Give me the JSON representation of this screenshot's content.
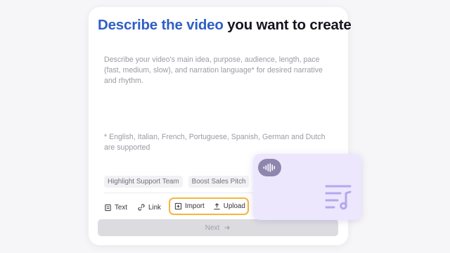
{
  "header": {
    "title_part1": "Describe the video",
    "title_part2": " you want to create"
  },
  "prompt": {
    "placeholder": "Describe your video's main idea, purpose, audience, length, pace (fast, medium, slow), and narration language* for desired narrative and rhythm.",
    "language_note": "* English, Italian, French, Portuguese, Spanish, German and Dutch are supported"
  },
  "suggestions": [
    "Highlight Support Team",
    "Boost Sales Pitch"
  ],
  "toolbar": {
    "text_label": "Text",
    "link_label": "Link",
    "import_label": "Import",
    "upload_label": "Upload"
  },
  "next_button": {
    "label": "Next"
  },
  "icons": {
    "text": "document-icon",
    "link": "link-icon",
    "import": "plus-square-icon",
    "upload": "upload-icon",
    "next_arrow": "arrow-right-icon",
    "audio": "sound-wave-icon",
    "music": "music-playlist-icon"
  },
  "colors": {
    "title_highlight": "#2f5fc6",
    "upload_group_border": "#f5b53a",
    "audio_card_bg": "#ece7fd",
    "next_button_bg": "#dcdce0"
  }
}
